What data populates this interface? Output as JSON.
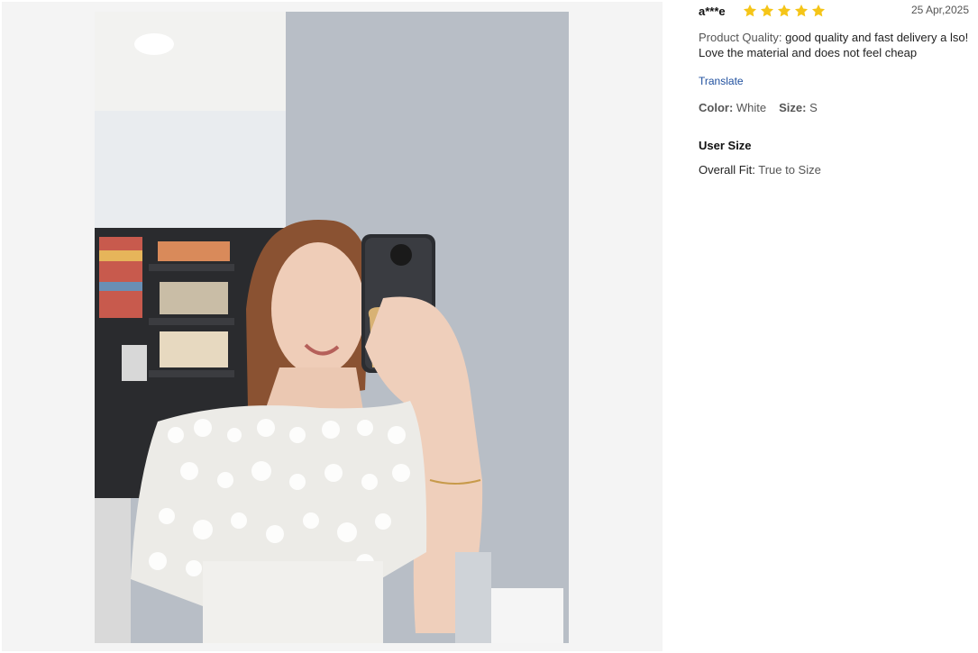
{
  "photo": {
    "alt": "Customer review photo: woman in white lace off-shoulder top taking a mirror selfie"
  },
  "review": {
    "reviewer": "a***e",
    "rating": 5,
    "rating_max": 5,
    "date": "25 Apr,2025",
    "comment_label": "Product Quality:",
    "comment_text": " good quality and fast delivery a lso! Love the material and does not feel cheap",
    "translate_label": "Translate",
    "color_label": "Color:",
    "color_value": "White",
    "size_label": "Size:",
    "size_value": "S",
    "user_size_title": "User Size",
    "fit_label": "Overall Fit:",
    "fit_value": "True to Size"
  },
  "colors": {
    "star": "#f5c518",
    "link": "#1f4f9e",
    "viewer_bg": "#f4f4f4"
  }
}
